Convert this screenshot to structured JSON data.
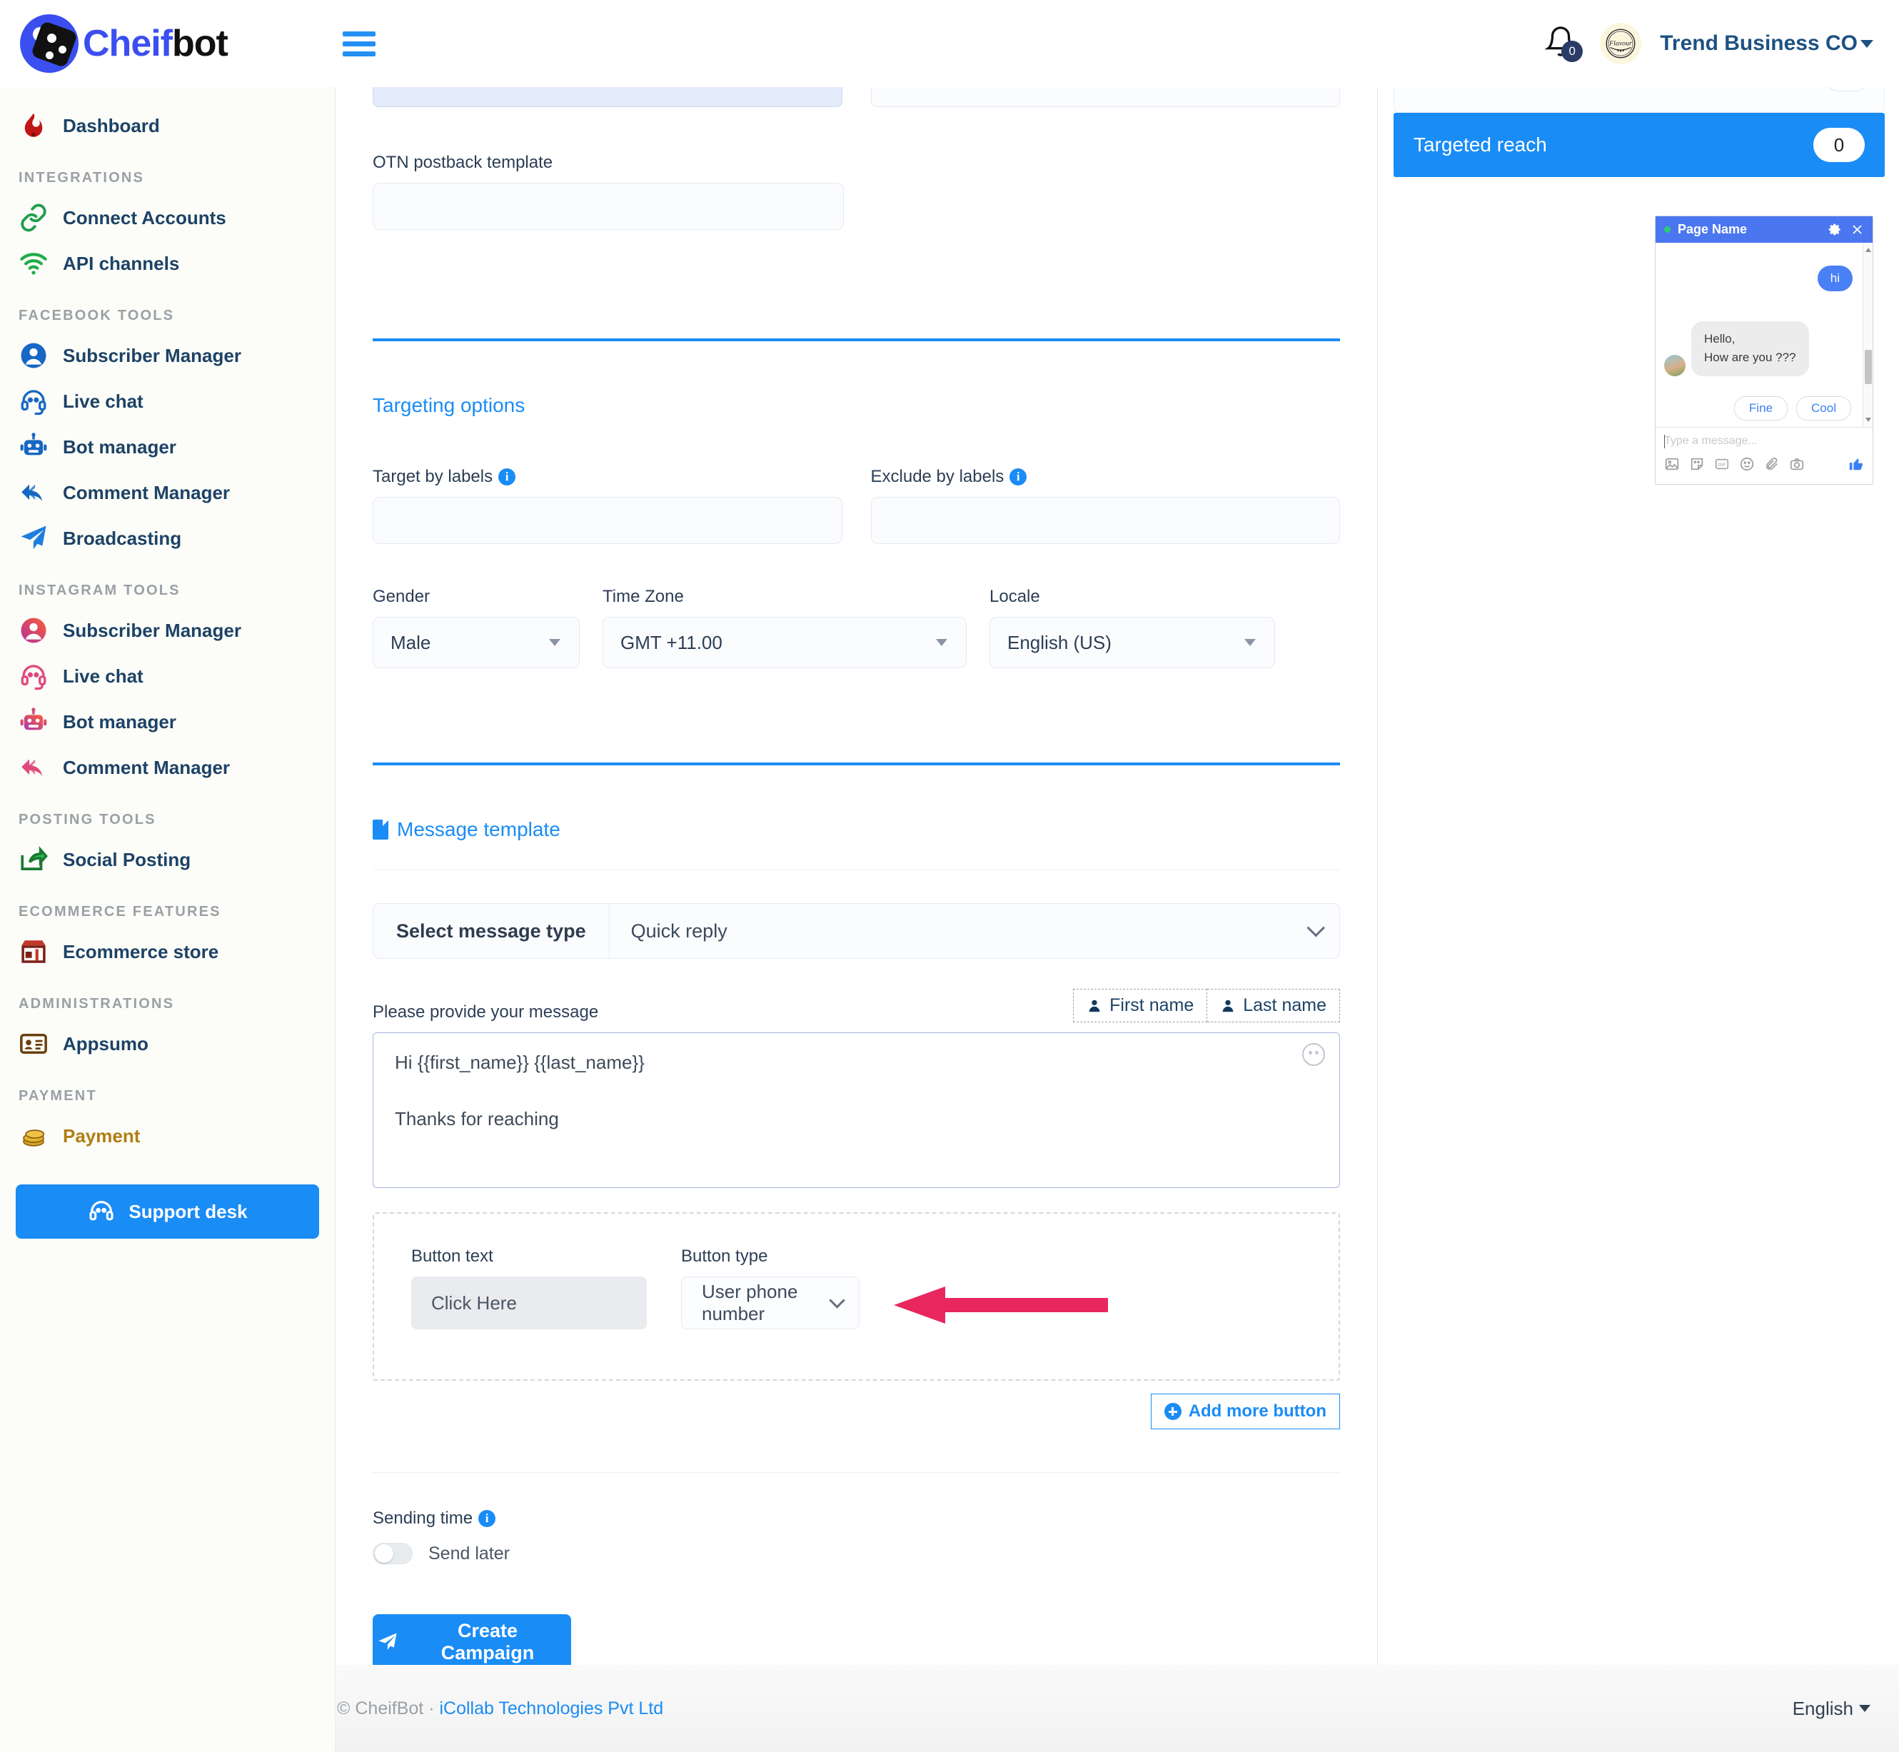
{
  "brand": {
    "name_part1": "Cheif",
    "name_part2": "bot",
    "accent": "#3b4ff0",
    "primary": "#1a8cf5"
  },
  "topbar": {
    "menu_icon": "hamburger-icon",
    "notification_count": "0",
    "user_name": "Trend Business CO"
  },
  "sidebar": {
    "items": [
      {
        "label": "Dashboard",
        "icon": "fire-icon"
      }
    ],
    "sections": [
      {
        "title": "INTEGRATIONS",
        "items": [
          {
            "label": "Connect Accounts",
            "icon": "link-icon"
          },
          {
            "label": "API channels",
            "icon": "wifi-icon"
          }
        ]
      },
      {
        "title": "FACEBOOK TOOLS",
        "items": [
          {
            "label": "Subscriber Manager",
            "icon": "user-circle-icon"
          },
          {
            "label": "Live chat",
            "icon": "headset-icon"
          },
          {
            "label": "Bot manager",
            "icon": "robot-icon"
          },
          {
            "label": "Comment Manager",
            "icon": "reply-all-icon"
          },
          {
            "label": "Broadcasting",
            "icon": "paper-plane-icon"
          }
        ]
      },
      {
        "title": "INSTAGRAM TOOLS",
        "items": [
          {
            "label": "Subscriber Manager",
            "icon": "user-circle-icon"
          },
          {
            "label": "Live chat",
            "icon": "headset-icon"
          },
          {
            "label": "Bot manager",
            "icon": "robot-icon"
          },
          {
            "label": "Comment Manager",
            "icon": "reply-all-icon"
          }
        ]
      },
      {
        "title": "POSTING TOOLS",
        "items": [
          {
            "label": "Social Posting",
            "icon": "share-square-icon"
          }
        ]
      },
      {
        "title": "ECOMMERCE FEATURES",
        "items": [
          {
            "label": "Ecommerce store",
            "icon": "store-icon"
          }
        ]
      },
      {
        "title": "ADMINISTRATIONS",
        "items": [
          {
            "label": "Appsumo",
            "icon": "id-card-icon"
          }
        ]
      },
      {
        "title": "PAYMENT",
        "items": [
          {
            "label": "Payment",
            "icon": "coins-icon"
          }
        ]
      }
    ],
    "support_button": "Support desk"
  },
  "form": {
    "otn_postback_label": "OTN postback template",
    "otn_postback_value": "",
    "targeting": {
      "title": "Targeting options",
      "target_by_labels_label": "Target by labels",
      "target_by_labels_value": "",
      "exclude_by_labels_label": "Exclude by labels",
      "exclude_by_labels_value": "",
      "gender_label": "Gender",
      "gender_value": "Male",
      "timezone_label": "Time Zone",
      "timezone_value": "GMT +11.00",
      "locale_label": "Locale",
      "locale_value": "English (US)"
    },
    "message_template": {
      "title": "Message template",
      "select_message_type_label": "Select message type",
      "select_message_type_value": "Quick reply",
      "message_label": "Please provide your message",
      "first_name_chip": "First name",
      "last_name_chip": "Last name",
      "message_line1": "Hi  {{first_name}} {{last_name}}",
      "message_line2": "Thanks for reaching",
      "button_text_label": "Button text",
      "button_text_value": "Click Here",
      "button_type_label": "Button type",
      "button_type_value": "User phone number",
      "add_more_button": "Add more button"
    },
    "sending_time_label": "Sending time",
    "send_later_label": "Send later",
    "create_campaign_button": "Create Campaign"
  },
  "right_panel": {
    "targeted_reach_label": "Targeted reach",
    "targeted_reach_value": "0",
    "chat_preview": {
      "page_name": "Page Name",
      "outgoing_message": "hi",
      "incoming_line1": "Hello,",
      "incoming_line2": "How are you  ???",
      "quick_replies": [
        "Fine",
        "Cool"
      ],
      "input_placeholder": "Type a message..."
    }
  },
  "footer": {
    "copyright": "© CheifBot  ·  ",
    "company_link": "iCollab Technologies Pvt Ltd",
    "language": "English"
  }
}
